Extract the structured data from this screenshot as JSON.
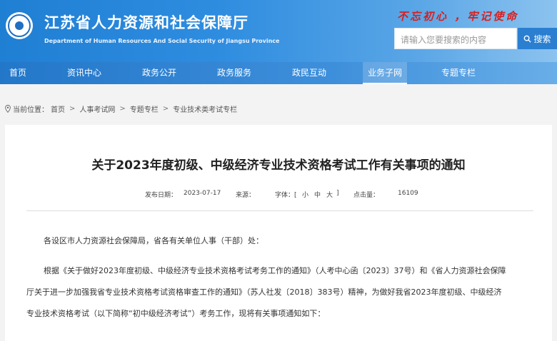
{
  "site": {
    "title": "江苏省人力资源和社会保障厅",
    "subtitle": "Department of Human Resources And Social Security of Jiangsu Province",
    "slogan": "不忘初心 ，牢记使命"
  },
  "search": {
    "placeholder": "请输入您要搜索的内容",
    "button_label": "搜索"
  },
  "nav": {
    "items": [
      {
        "label": "首页"
      },
      {
        "label": "资讯中心"
      },
      {
        "label": "政务公开"
      },
      {
        "label": "政务服务"
      },
      {
        "label": "政民互动"
      },
      {
        "label": "业务子网"
      },
      {
        "label": "专题专栏"
      }
    ],
    "active": "业务子网"
  },
  "breadcrumb": {
    "prefix": "当前位置：",
    "items": [
      "首页",
      "人事考试网",
      "专题专栏",
      "专业技术类考试专栏"
    ],
    "separator": ">"
  },
  "article": {
    "title": "关于2023年度初级、中级经济专业技术资格考试工作有关事项的通知",
    "publish_label": "发布日期：",
    "publish_date": "2023-07-17",
    "source_label": "来源：",
    "font_label": "字体：[",
    "font_small": "小",
    "font_medium": "中",
    "font_large": "大",
    "font_close": "]",
    "hits_label": "点击量：",
    "hits": "16109",
    "greeting": "各设区市人力资源社会保障局，省各有关单位人事（干部）处：",
    "body_line1": "根据《关于做好2023年度初级、中级经济专业技术资格考试考务工作的通知》（人考中心函〔2023〕37号）和《省人力资源社会保障",
    "body_line2": "厅关于进一步加强我省专业技术资格考试资格审查工作的通知》（苏人社发〔2018〕383号）精神，为做好我省2023年度初级、中级经济",
    "body_line3": "专业技术资格考试（以下简称“初中级经济考试”）考务工作，现将有关事项通知如下："
  },
  "colors": {
    "header": "#1f7fd3",
    "slogan": "#d62020",
    "search_button": "#2a7fd1"
  }
}
